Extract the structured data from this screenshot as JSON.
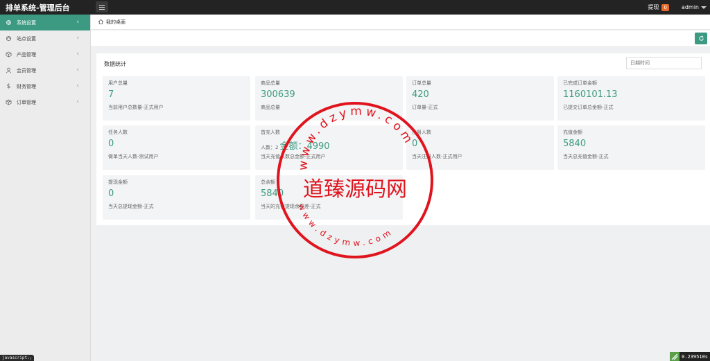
{
  "header": {
    "title": "排单系统-管理后台",
    "withdraw_label": "提现",
    "withdraw_count": "0",
    "user": "admin"
  },
  "sidebar": {
    "items": [
      {
        "label": "系统设置",
        "icon": "gear-icon",
        "active": true
      },
      {
        "label": "站点设置",
        "icon": "cloud-icon",
        "active": false
      },
      {
        "label": "产品管理",
        "icon": "box-icon",
        "active": false
      },
      {
        "label": "会员管理",
        "icon": "user-icon",
        "active": false
      },
      {
        "label": "财务管理",
        "icon": "dollar-icon",
        "active": false
      },
      {
        "label": "订单管理",
        "icon": "package-icon",
        "active": false
      }
    ]
  },
  "breadcrumb": {
    "label": "我的桌面"
  },
  "panel": {
    "title": "数据统计",
    "date_placeholder": "日期时间"
  },
  "cards": [
    {
      "label": "用户总量",
      "value": "7",
      "desc": "当前用户总数量-正式用户"
    },
    {
      "label": "商品总量",
      "value": "300639",
      "desc": "商品总量"
    },
    {
      "label": "订单总量",
      "value": "420",
      "desc": "订单量-正式"
    },
    {
      "label": "已完成订单金额",
      "value": "1160101.13",
      "desc": "已提交订单总金额-正式"
    },
    {
      "label": "任务人数",
      "value": "0",
      "desc": "做单当天人数-测试用户"
    },
    {
      "label": "首充人数",
      "value_prefix": "人数：2",
      "value": "金额：4990",
      "desc": "当天充值人数总金额-正式用户"
    },
    {
      "label": "注册人数",
      "value": "0",
      "desc": "当天注册人数-正式用户"
    },
    {
      "label": "充值金额",
      "value": "5840",
      "desc": "当天总充值金额-正式"
    },
    {
      "label": "提现金额",
      "value": "0",
      "desc": "当天总提现金额-正式"
    },
    {
      "label": "总余额",
      "value": "5840",
      "desc": "当天的充值提现余额差-正式"
    }
  ],
  "watermark": {
    "center_text": "道臻源码网",
    "ring_top": "www.dzymw.com",
    "ring_bottom": "www.dzymw.com",
    "color": "#e0141e"
  },
  "footer": {
    "status_text": "javascript:;",
    "perf_text": "0.239510s"
  },
  "colors": {
    "accent": "#3c9a82",
    "topbar": "#232323",
    "badge": "#e86a2b"
  }
}
